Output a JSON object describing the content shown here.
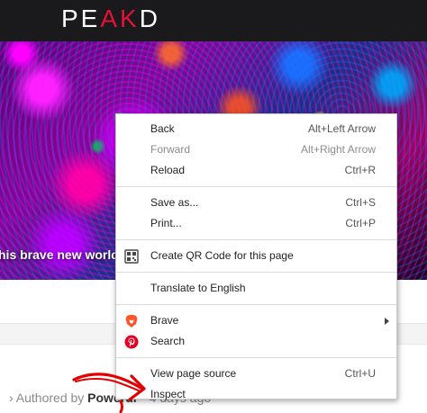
{
  "header": {
    "logo_prefix": "PE",
    "logo_accent": "AK",
    "logo_suffix": "D",
    "background": "#1a1a1d",
    "accent_color": "#e31337"
  },
  "hero": {
    "caption": "his brave new world."
  },
  "post": {
    "authored_prefix": "Authored by ",
    "author_name": "Power",
    "author_name_tail": "ur",
    "time_ago": "4 days ago"
  },
  "context_menu": {
    "sections": [
      {
        "items": [
          {
            "label": "Back",
            "shortcut": "Alt+Left Arrow",
            "enabled": true
          },
          {
            "label": "Forward",
            "shortcut": "Alt+Right Arrow",
            "enabled": false
          },
          {
            "label": "Reload",
            "shortcut": "Ctrl+R",
            "enabled": true
          }
        ]
      },
      {
        "items": [
          {
            "label": "Save as...",
            "shortcut": "Ctrl+S",
            "enabled": true
          },
          {
            "label": "Print...",
            "shortcut": "Ctrl+P",
            "enabled": true
          }
        ]
      },
      {
        "items": [
          {
            "label": "Create QR Code for this page",
            "shortcut": "",
            "icon": "qr-code-icon",
            "enabled": true
          }
        ]
      },
      {
        "items": [
          {
            "label": "Translate to English",
            "shortcut": "",
            "enabled": true
          }
        ]
      },
      {
        "items": [
          {
            "label": "Brave",
            "shortcut": "",
            "icon": "brave-lion-icon",
            "submenu": true,
            "enabled": true
          },
          {
            "label": "Search",
            "shortcut": "",
            "icon": "pinterest-icon",
            "enabled": true
          }
        ]
      },
      {
        "items": [
          {
            "label": "View page source",
            "shortcut": "Ctrl+U",
            "enabled": true
          },
          {
            "label": "Inspect",
            "shortcut": "",
            "enabled": true
          }
        ]
      }
    ]
  },
  "annotation": {
    "arrow_color": "#e00000",
    "icon": "hand-drawn-red-arrow-icon"
  }
}
